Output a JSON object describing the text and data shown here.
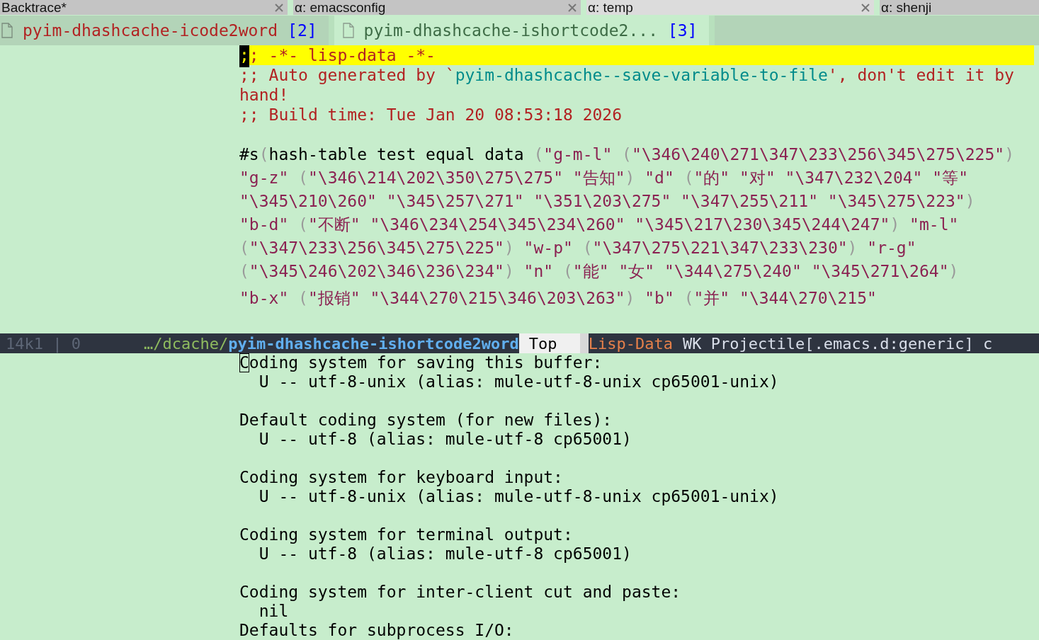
{
  "frame_tabs": [
    {
      "label": "Backtrace*",
      "selected": false,
      "closable": true
    },
    {
      "label": "α: emacsconfig",
      "selected": false,
      "closable": true
    },
    {
      "label": "α: temp",
      "selected": true,
      "closable": true
    },
    {
      "label": "α: shenji",
      "selected": false,
      "closable": false
    }
  ],
  "tab_line": [
    {
      "name": "pyim-dhashcache-icode2word",
      "number": "[2]",
      "selected": false
    },
    {
      "name": "pyim-dhashcache-ishortcode2...",
      "number": "[3]",
      "selected": true
    }
  ],
  "upper_buffer": {
    "lines": [
      {
        "highlighted": true,
        "segments": [
          {
            "kind": "cursor",
            "text": ";"
          },
          {
            "kind": "comment",
            "text": "; -*- lisp-data -*-"
          }
        ]
      },
      {
        "highlighted": false,
        "segments": [
          {
            "kind": "comment",
            "text": ";; Auto generated by `"
          },
          {
            "kind": "constant",
            "text": "pyim-dhashcache--save-variable-to-file"
          },
          {
            "kind": "comment",
            "text": "', don't edit it by"
          }
        ]
      },
      {
        "highlighted": false,
        "segments": [
          {
            "kind": "comment",
            "text": "hand!"
          }
        ]
      },
      {
        "highlighted": false,
        "segments": [
          {
            "kind": "comment",
            "text": ";; Build time: Tue Jan 20 08:53:18 2026"
          }
        ]
      },
      {
        "highlighted": false
      },
      {
        "highlighted": false,
        "segments": [
          {
            "kind": "plain",
            "text": "#s"
          },
          {
            "kind": "paren",
            "text": "("
          },
          {
            "kind": "plain",
            "text": "hash-table test equal data "
          },
          {
            "kind": "paren",
            "text": "("
          },
          {
            "kind": "string",
            "text": "\"g-m-l\" "
          },
          {
            "kind": "paren",
            "text": "("
          },
          {
            "kind": "string",
            "text": "\"\\346\\240\\271\\347\\233\\256\\345\\275\\225\""
          },
          {
            "kind": "paren",
            "text": ")"
          }
        ]
      },
      {
        "highlighted": false,
        "segments": [
          {
            "kind": "string",
            "text": "\"g-z\" "
          },
          {
            "kind": "paren",
            "text": "("
          },
          {
            "kind": "string",
            "text": "\"\\346\\214\\202\\350\\275\\275\" \"告知\""
          },
          {
            "kind": "paren",
            "text": ")"
          },
          {
            "kind": "string",
            "text": " \"d\" "
          },
          {
            "kind": "paren",
            "text": "("
          },
          {
            "kind": "string",
            "text": "\"的\" \"对\" \"\\347\\232\\204\" \"等\""
          }
        ]
      },
      {
        "highlighted": false,
        "segments": [
          {
            "kind": "string",
            "text": "\"\\345\\210\\260\" \"\\345\\257\\271\" \"\\351\\203\\275\" \"\\347\\255\\211\" \"\\345\\275\\223\""
          },
          {
            "kind": "paren",
            "text": ")"
          }
        ]
      },
      {
        "highlighted": false,
        "segments": [
          {
            "kind": "string",
            "text": "\"b-d\" "
          },
          {
            "kind": "paren",
            "text": "("
          },
          {
            "kind": "string",
            "text": "\"不断\" \"\\346\\234\\254\\345\\234\\260\" \"\\345\\217\\230\\345\\244\\247\""
          },
          {
            "kind": "paren",
            "text": ")"
          },
          {
            "kind": "string",
            "text": " \"m-l\""
          }
        ]
      },
      {
        "highlighted": false,
        "segments": [
          {
            "kind": "paren",
            "text": "("
          },
          {
            "kind": "string",
            "text": "\"\\347\\233\\256\\345\\275\\225\""
          },
          {
            "kind": "paren",
            "text": ")"
          },
          {
            "kind": "string",
            "text": " \"w-p\" "
          },
          {
            "kind": "paren",
            "text": "("
          },
          {
            "kind": "string",
            "text": "\"\\347\\275\\221\\347\\233\\230\""
          },
          {
            "kind": "paren",
            "text": ")"
          },
          {
            "kind": "string",
            "text": " \"r-g\""
          }
        ]
      },
      {
        "highlighted": false,
        "segments": [
          {
            "kind": "paren",
            "text": "("
          },
          {
            "kind": "string",
            "text": "\"\\345\\246\\202\\346\\236\\234\""
          },
          {
            "kind": "paren",
            "text": ")"
          },
          {
            "kind": "string",
            "text": " \"n\" "
          },
          {
            "kind": "paren",
            "text": "("
          },
          {
            "kind": "string",
            "text": "\"能\" \"女\" \"\\344\\275\\240\" \"\\345\\271\\264\""
          },
          {
            "kind": "paren",
            "text": ")"
          }
        ]
      },
      {
        "highlighted": false,
        "segments": [
          {
            "kind": "string",
            "text": "\"b-x\" "
          },
          {
            "kind": "paren",
            "text": "("
          },
          {
            "kind": "string",
            "text": "\"报销\" \"\\344\\270\\215\\346\\203\\263\""
          },
          {
            "kind": "paren",
            "text": ")"
          },
          {
            "kind": "string",
            "text": " \"b\" "
          },
          {
            "kind": "paren",
            "text": "("
          },
          {
            "kind": "string",
            "text": "\"并\" \"\\344\\270\\215\""
          }
        ]
      }
    ]
  },
  "mode_line": {
    "position": "14k1 | 0",
    "directory": "…/dcache/",
    "file": "pyim-dhashcache-ishortcode2word",
    "scroll": "Top",
    "major_mode": "Lisp-Data",
    "minor_modes": "WK Projectile[.emacs.d:generic] c"
  },
  "lower_buffer": {
    "paragraphs": [
      {
        "lines": [
          {
            "segments": [
              {
                "kind": "box-cursor",
                "text": "C"
              },
              {
                "kind": "plain",
                "text": "oding system for saving this buffer:"
              }
            ]
          },
          {
            "segments": [
              {
                "kind": "plain",
                "text": "  U -- utf-8-unix (alias: mule-utf-8-unix cp65001-unix)"
              }
            ]
          }
        ]
      },
      {
        "lines": [
          {
            "segments": [
              {
                "kind": "plain",
                "text": "Default coding system (for new files):"
              }
            ]
          },
          {
            "segments": [
              {
                "kind": "plain",
                "text": "  U -- utf-8 (alias: mule-utf-8 cp65001)"
              }
            ]
          }
        ]
      },
      {
        "lines": [
          {
            "segments": [
              {
                "kind": "plain",
                "text": "Coding system for keyboard input:"
              }
            ]
          },
          {
            "segments": [
              {
                "kind": "plain",
                "text": "  U -- utf-8-unix (alias: mule-utf-8-unix cp65001-unix)"
              }
            ]
          }
        ]
      },
      {
        "lines": [
          {
            "segments": [
              {
                "kind": "plain",
                "text": "Coding system for terminal output:"
              }
            ]
          },
          {
            "segments": [
              {
                "kind": "plain",
                "text": "  U -- utf-8 (alias: mule-utf-8 cp65001)"
              }
            ]
          }
        ]
      },
      {
        "lines": [
          {
            "segments": [
              {
                "kind": "plain",
                "text": "Coding system for inter-client cut and paste:"
              }
            ]
          },
          {
            "segments": [
              {
                "kind": "plain",
                "text": "  nil"
              }
            ]
          },
          {
            "segments": [
              {
                "kind": "plain",
                "text": "Defaults for subprocess I/O:"
              }
            ]
          }
        ]
      }
    ]
  }
}
